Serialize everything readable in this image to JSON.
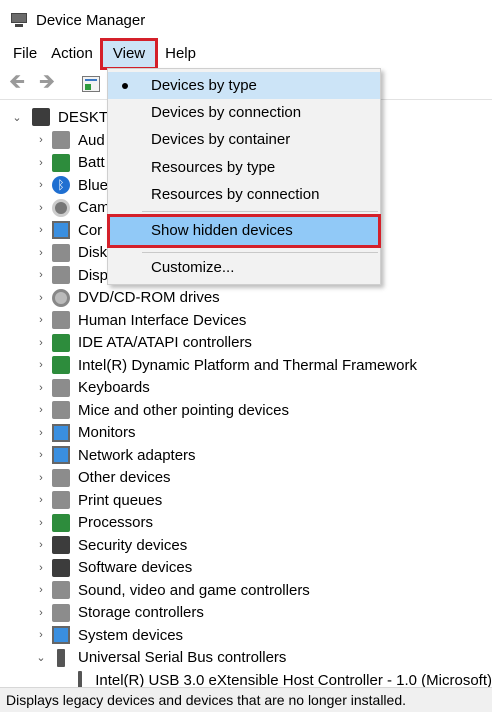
{
  "window": {
    "title": "Device Manager"
  },
  "menubar": {
    "items": [
      "File",
      "Action",
      "View",
      "Help"
    ]
  },
  "toolbar": {
    "back": "back-arrow",
    "forward": "forward-arrow",
    "properties": "properties-sheet"
  },
  "tree": {
    "root": "DESKTOP",
    "items": [
      {
        "label": "Audio inputs and outputs",
        "visible": "Aud",
        "icon": "speaker-icon"
      },
      {
        "label": "Batteries",
        "visible": "Batt",
        "icon": "battery-icon"
      },
      {
        "label": "Bluetooth",
        "visible": "Blue",
        "icon": "bluetooth-icon"
      },
      {
        "label": "Cameras",
        "visible": "Cam",
        "icon": "camera-icon"
      },
      {
        "label": "Computer",
        "visible": "Cor",
        "icon": "computer-icon"
      },
      {
        "label": "Disk drives",
        "visible": "Disk",
        "icon": "disk-drive-icon"
      },
      {
        "label": "Display adapters",
        "visible": "Disp",
        "icon": "display-adapter-icon"
      },
      {
        "label": "DVD/CD-ROM drives",
        "visible": "DVD/CD-ROM drives",
        "icon": "dvd-icon"
      },
      {
        "label": "Human Interface Devices",
        "visible": "Human Interface Devices",
        "icon": "hid-icon"
      },
      {
        "label": "IDE ATA/ATAPI controllers",
        "visible": "IDE ATA/ATAPI controllers",
        "icon": "ide-controller-icon"
      },
      {
        "label": "Intel(R) Dynamic Platform and Thermal Framework",
        "visible": "Intel(R) Dynamic Platform and Thermal Framework",
        "icon": "chip-icon"
      },
      {
        "label": "Keyboards",
        "visible": "Keyboards",
        "icon": "keyboard-icon"
      },
      {
        "label": "Mice and other pointing devices",
        "visible": "Mice and other pointing devices",
        "icon": "mouse-icon"
      },
      {
        "label": "Monitors",
        "visible": "Monitors",
        "icon": "monitor-icon"
      },
      {
        "label": "Network adapters",
        "visible": "Network adapters",
        "icon": "network-icon"
      },
      {
        "label": "Other devices",
        "visible": "Other devices",
        "icon": "unknown-device-icon"
      },
      {
        "label": "Print queues",
        "visible": "Print queues",
        "icon": "printer-icon"
      },
      {
        "label": "Processors",
        "visible": "Processors",
        "icon": "processor-icon"
      },
      {
        "label": "Security devices",
        "visible": "Security devices",
        "icon": "security-icon"
      },
      {
        "label": "Software devices",
        "visible": "Software devices",
        "icon": "software-device-icon"
      },
      {
        "label": "Sound, video and game controllers",
        "visible": "Sound, video and game controllers",
        "icon": "sound-icon"
      },
      {
        "label": "Storage controllers",
        "visible": "Storage controllers",
        "icon": "storage-icon"
      },
      {
        "label": "System devices",
        "visible": "System devices",
        "icon": "system-icon"
      },
      {
        "label": "Universal Serial Bus controllers",
        "visible": "Universal Serial Bus controllers",
        "icon": "usb-icon",
        "expanded": true
      },
      {
        "label": "Intel(R) USB 3.0 eXtensible Host Controller - 1.0 (Microsoft)",
        "visible": "Intel(R) USB 3.0 eXtensible Host Controller - 1.0 (Microsoft)",
        "icon": "usb-device-icon",
        "child": true
      }
    ]
  },
  "view_menu": {
    "items": [
      {
        "label": "Devices by type",
        "checked": true
      },
      {
        "label": "Devices by connection"
      },
      {
        "label": "Devices by container"
      },
      {
        "label": "Resources by type"
      },
      {
        "label": "Resources by connection"
      },
      {
        "label": "Show hidden devices",
        "highlighted": true
      },
      {
        "label": "Customize..."
      }
    ]
  },
  "status": {
    "text": "Displays legacy devices and devices that are no longer installed."
  },
  "colors": {
    "highlight": "#91c9f7",
    "annotation_red": "#d4202a",
    "menu_bg": "#f2f2f2"
  }
}
